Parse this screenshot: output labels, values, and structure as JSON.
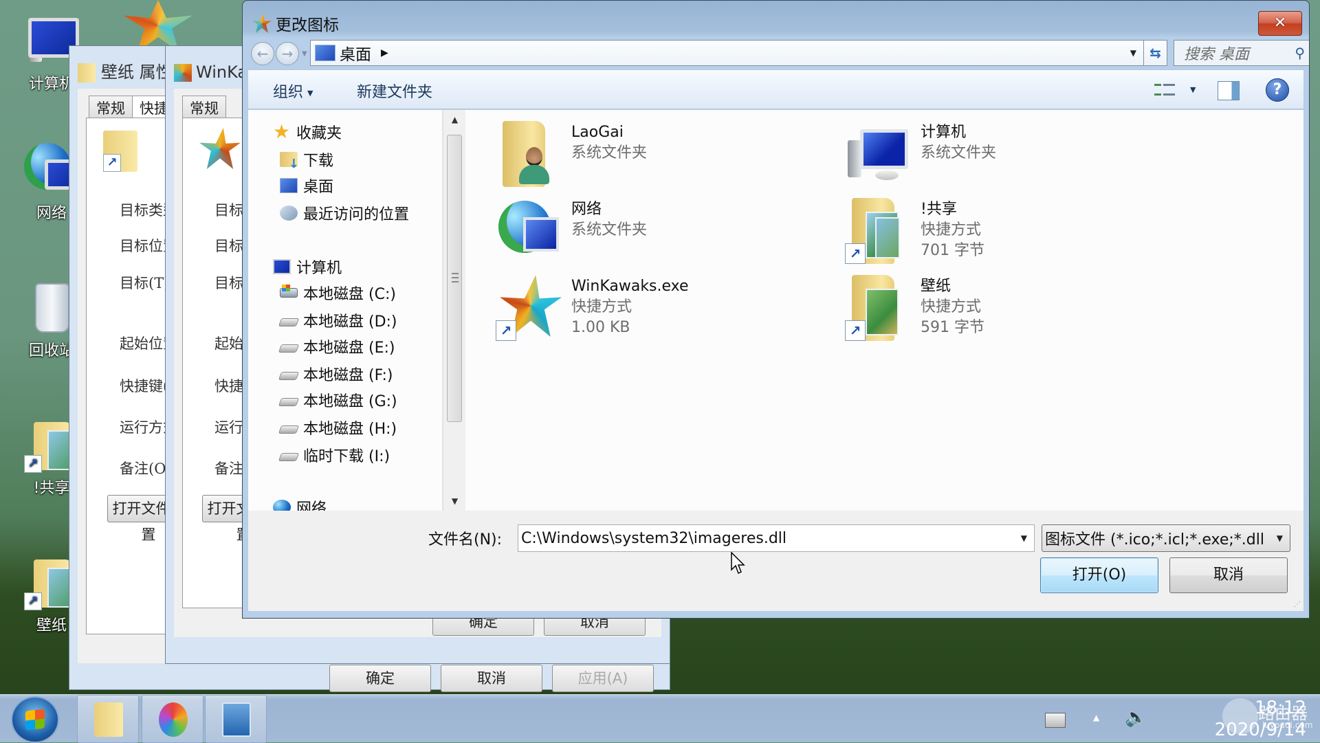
{
  "desktop": {
    "icons": [
      {
        "label": "计算机",
        "icon": "computer-icon"
      },
      {
        "label": "网络",
        "icon": "network-icon"
      },
      {
        "label": "回收站",
        "icon": "recycle-bin-icon"
      },
      {
        "label": "!共享",
        "icon": "shortcut-folder-icon"
      },
      {
        "label": "壁纸",
        "icon": "shortcut-folder-icon"
      }
    ]
  },
  "bg_window_1": {
    "title": "壁纸 属性",
    "tabs": [
      "常规",
      "快捷方式"
    ],
    "labels": [
      "目标类型",
      "目标位置",
      "目标(T)",
      "起始位置",
      "快捷键(K)",
      "运行方式",
      "备注(O)"
    ],
    "open_button": "打开文件位置",
    "ok": "确定",
    "cancel": "取消",
    "apply": "应用(A)"
  },
  "bg_window_2": {
    "title": "WinKawaks.exe 属性",
    "tabs": [
      "常规"
    ],
    "labels": [
      "目标类型",
      "目标位置",
      "目标(T)",
      "起始位置",
      "快捷键(K)",
      "运行方式",
      "备注(O)"
    ],
    "open_button": "打开文件位置",
    "ok": "确定",
    "cancel": "取消"
  },
  "dialog": {
    "title": "更改图标",
    "close_label": "✕",
    "address": {
      "crumb": "桌面"
    },
    "search_placeholder": "搜索 桌面",
    "toolbar": {
      "organize": "组织",
      "new_folder": "新建文件夹"
    },
    "nav": {
      "favorites": "收藏夹",
      "downloads": "下载",
      "desktop": "桌面",
      "recent": "最近访问的位置",
      "computer": "计算机",
      "drives": [
        "本地磁盘 (C:)",
        "本地磁盘 (D:)",
        "本地磁盘 (E:)",
        "本地磁盘 (F:)",
        "本地磁盘 (G:)",
        "本地磁盘 (H:)",
        "临时下载 (I:)"
      ],
      "network": "网络"
    },
    "items": [
      {
        "name": "LaoGai",
        "line1": "系统文件夹",
        "line2": ""
      },
      {
        "name": "计算机",
        "line1": "系统文件夹",
        "line2": ""
      },
      {
        "name": "网络",
        "line1": "系统文件夹",
        "line2": ""
      },
      {
        "name": "!共享",
        "line1": "快捷方式",
        "line2": "701 字节"
      },
      {
        "name": "WinKawaks.exe",
        "line1": "快捷方式",
        "line2": "1.00 KB"
      },
      {
        "name": "壁纸",
        "line1": "快捷方式",
        "line2": "591 字节"
      }
    ],
    "filename_label": "文件名(N):",
    "filename_value": "C:\\Windows\\system32\\imageres.dll",
    "filetype_value": "图标文件 (*.ico;*.icl;*.exe;*.dll",
    "open_button": "打开(O)",
    "cancel_button": "取消"
  },
  "taskbar": {
    "time": "18:12",
    "date": "2020/9/14",
    "watermark": "路由器",
    "watermark_sub": "luyouqi.com"
  }
}
